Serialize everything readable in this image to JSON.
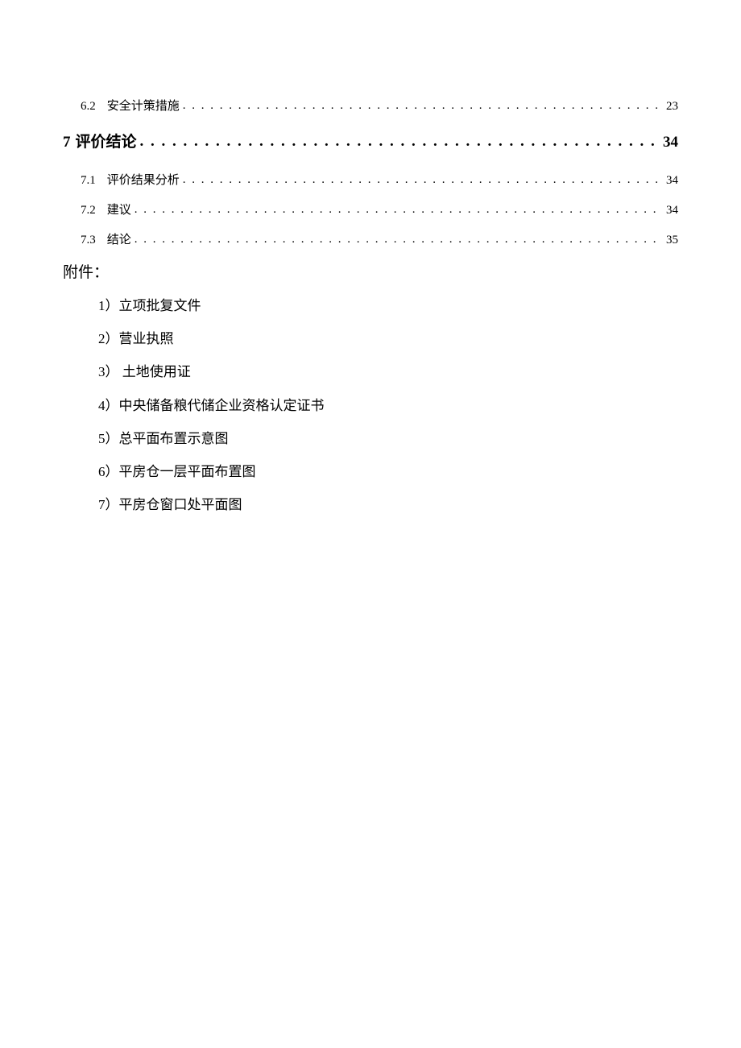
{
  "toc": [
    {
      "level": 2,
      "number": "6.2",
      "title": "安全计策措施",
      "page": "23"
    },
    {
      "level": 1,
      "number": "7",
      "title": "评价结论",
      "page": "34"
    },
    {
      "level": 2,
      "number": "7.1",
      "title": "评价结果分析",
      "page": "34"
    },
    {
      "level": 2,
      "number": "7.2",
      "title": "建议",
      "page": "34"
    },
    {
      "level": 2,
      "number": "7.3",
      "title": "结论",
      "page": "35"
    }
  ],
  "attachments_heading": "附件：",
  "attachments": [
    "1）立项批复文件",
    "2）营业执照",
    "3） 土地使用证",
    "4）中央储备粮代储企业资格认定证书",
    "5）总平面布置示意图",
    "6）平房仓一层平面布置图",
    "7）平房仓窗口处平面图"
  ]
}
